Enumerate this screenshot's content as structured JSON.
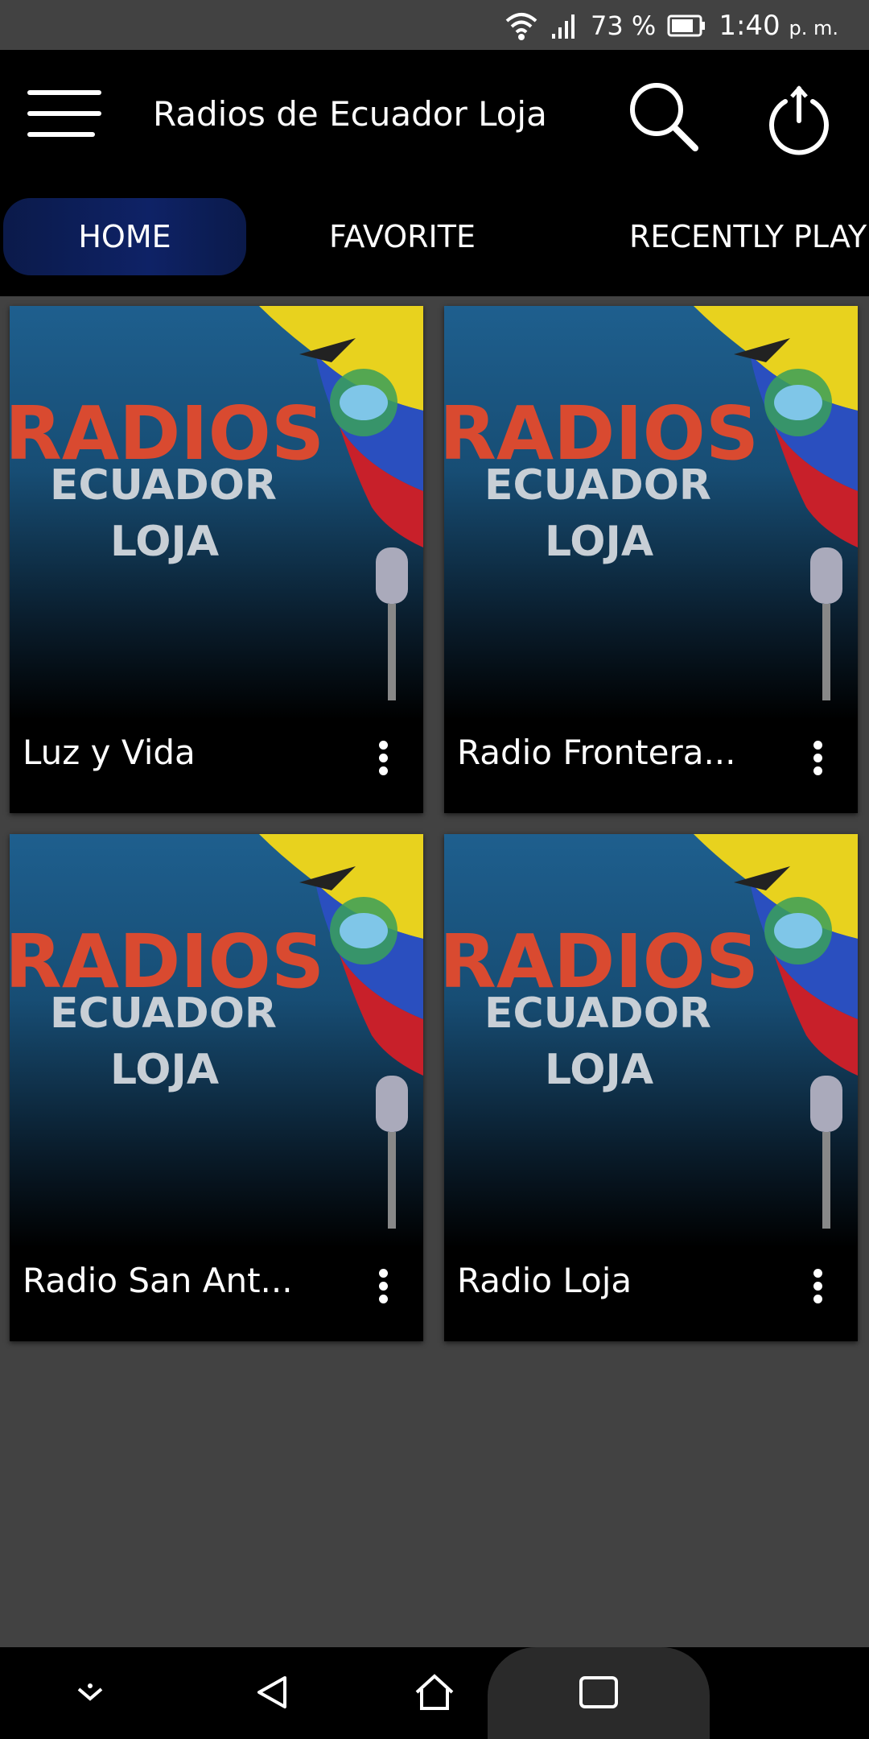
{
  "status_bar": {
    "battery_percent": "73 %",
    "time": "1:40",
    "time_suffix": "p. m.",
    "icons": [
      "wifi-icon",
      "signal-icon",
      "battery-icon"
    ]
  },
  "app_bar": {
    "title": "Radios de Ecuador Loja",
    "icons": [
      "menu-icon",
      "search-icon",
      "power-icon"
    ]
  },
  "tabs": [
    {
      "label": "HOME",
      "selected": true
    },
    {
      "label": "FAVORITE",
      "selected": false
    },
    {
      "label": "RECENTLY PLAYED",
      "selected": false
    }
  ],
  "artwork": {
    "line1": "RADIOS",
    "line2": "ECUADOR",
    "line3": "LOJA"
  },
  "stations": [
    {
      "name": "Luz y Vida"
    },
    {
      "name": "Radio Frontera..."
    },
    {
      "name": "Radio San Ant..."
    },
    {
      "name": "Radio Loja"
    }
  ],
  "nav_bar": {
    "icons": [
      "hide-nav-icon",
      "back-icon",
      "home-icon",
      "recents-icon"
    ]
  },
  "colors": {
    "background": "#424242",
    "app_bar": "#000000",
    "tab_selected": "#0e2266",
    "art_top": "#1e5f8e",
    "art_red": "#d94a30",
    "art_gray": "#c8cfd6"
  }
}
